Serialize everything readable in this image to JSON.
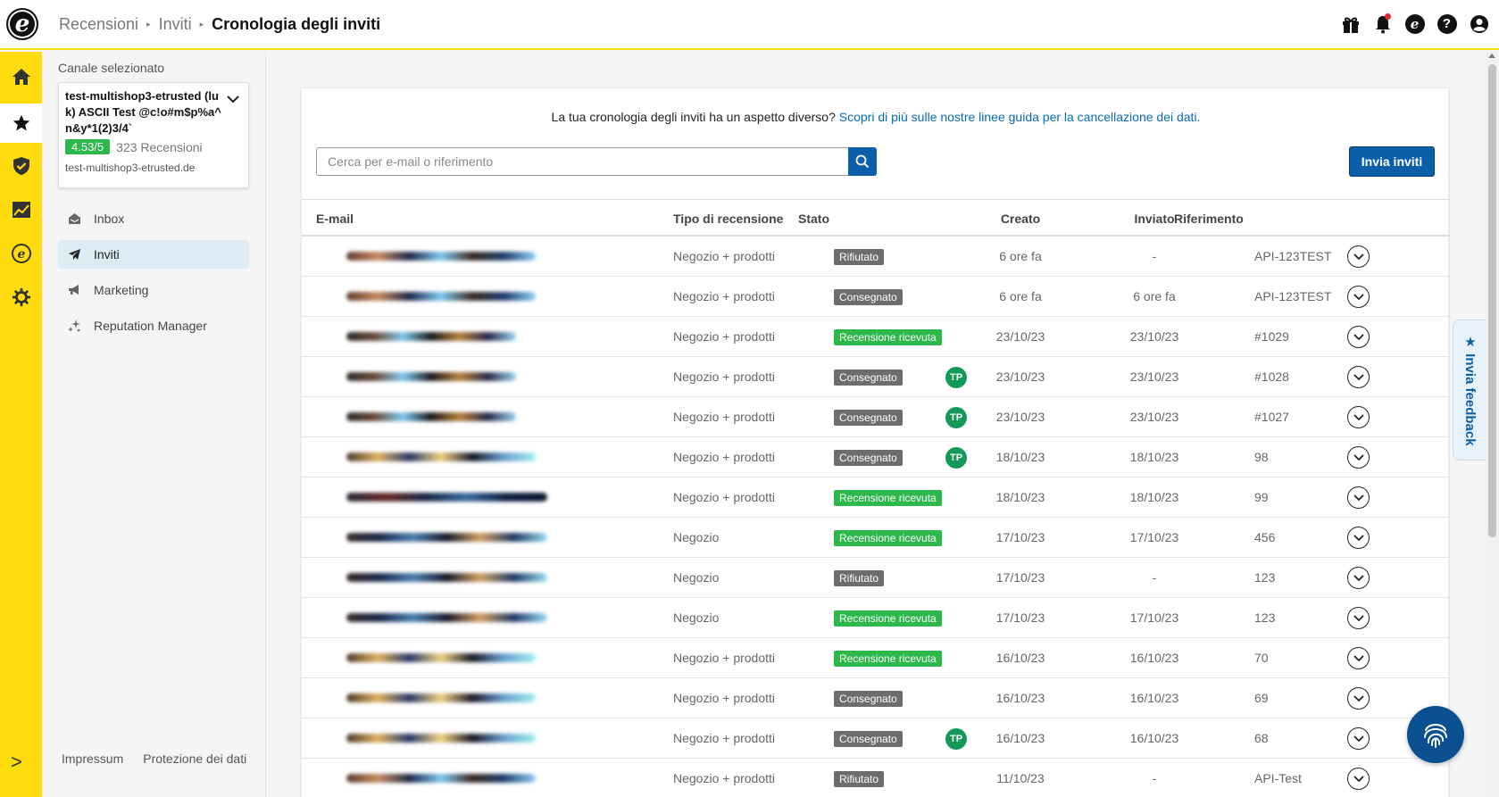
{
  "header": {
    "logo": "e",
    "breadcrumbs": [
      "Recensioni",
      "Inviti"
    ],
    "current": "Cronologia degli inviti",
    "icons": [
      "gift-icon",
      "bell-icon",
      "etrusted-icon",
      "help-icon",
      "account-icon"
    ],
    "etrusted_glyph": "e",
    "help_glyph": "?"
  },
  "rail": {
    "items": [
      "home-icon",
      "star-icon",
      "shield-icon",
      "chart-icon",
      "etrusted-icon",
      "gear-icon"
    ],
    "active_index": 1,
    "expand_glyph": ">"
  },
  "sidepanel": {
    "channel_label": "Canale selezionato",
    "channel_name": "test-multishop3-etrusted (luk) ASCII Test @c!o#m$p%a^n&y*1(2)3/4`",
    "rating": "4.53/5",
    "review_count": "323 Recensioni",
    "channel_url": "test-multishop3-etrusted.de",
    "nav": [
      {
        "label": "Inbox",
        "icon": "inbox-icon"
      },
      {
        "label": "Inviti",
        "icon": "paper-plane-icon"
      },
      {
        "label": "Marketing",
        "icon": "megaphone-icon"
      },
      {
        "label": "Reputation Manager",
        "icon": "sparkle-icon"
      }
    ],
    "footer": [
      "Impressum",
      "Protezione dei dati"
    ]
  },
  "main": {
    "notice_text": "La tua cronologia degli inviti ha un aspetto diverso? ",
    "notice_link": "Scopri di più sulle nostre linee guida per la cancellazione dei dati.",
    "search_placeholder": "Cerca per e-mail o riferimento",
    "send_button": "Invia inviti",
    "columns": [
      "E-mail",
      "Tipo di recensione",
      "Stato",
      "Creato",
      "Inviato",
      "Riferimento"
    ],
    "rows": [
      {
        "type": "Negozio + prodotti",
        "status": "Rifiutato",
        "status_color": "grey",
        "tp": "",
        "created": "6 ore fa",
        "sent": "-",
        "ref": "API-123TEST"
      },
      {
        "type": "Negozio + prodotti",
        "status": "Consegnato",
        "status_color": "grey",
        "tp": "",
        "created": "6 ore fa",
        "sent": "6 ore fa",
        "ref": "API-123TEST"
      },
      {
        "type": "Negozio + prodotti",
        "status": "Recensione ricevuta",
        "status_color": "green",
        "tp": "",
        "created": "23/10/23",
        "sent": "23/10/23",
        "ref": "#1029"
      },
      {
        "type": "Negozio + prodotti",
        "status": "Consegnato",
        "status_color": "grey",
        "tp": "TP",
        "created": "23/10/23",
        "sent": "23/10/23",
        "ref": "#1028"
      },
      {
        "type": "Negozio + prodotti",
        "status": "Consegnato",
        "status_color": "grey",
        "tp": "TP",
        "created": "23/10/23",
        "sent": "23/10/23",
        "ref": "#1027"
      },
      {
        "type": "Negozio + prodotti",
        "status": "Consegnato",
        "status_color": "grey",
        "tp": "TP",
        "created": "18/10/23",
        "sent": "18/10/23",
        "ref": "98"
      },
      {
        "type": "Negozio + prodotti",
        "status": "Recensione ricevuta",
        "status_color": "green",
        "tp": "",
        "created": "18/10/23",
        "sent": "18/10/23",
        "ref": "99"
      },
      {
        "type": "Negozio",
        "status": "Recensione ricevuta",
        "status_color": "green",
        "tp": "",
        "created": "17/10/23",
        "sent": "17/10/23",
        "ref": "456"
      },
      {
        "type": "Negozio",
        "status": "Rifiutato",
        "status_color": "grey",
        "tp": "",
        "created": "17/10/23",
        "sent": "-",
        "ref": "123"
      },
      {
        "type": "Negozio",
        "status": "Recensione ricevuta",
        "status_color": "green",
        "tp": "",
        "created": "17/10/23",
        "sent": "17/10/23",
        "ref": "123"
      },
      {
        "type": "Negozio + prodotti",
        "status": "Recensione ricevuta",
        "status_color": "green",
        "tp": "",
        "created": "16/10/23",
        "sent": "16/10/23",
        "ref": "70"
      },
      {
        "type": "Negozio + prodotti",
        "status": "Consegnato",
        "status_color": "grey",
        "tp": "",
        "created": "16/10/23",
        "sent": "16/10/23",
        "ref": "69"
      },
      {
        "type": "Negozio + prodotti",
        "status": "Consegnato",
        "status_color": "grey",
        "tp": "TP",
        "created": "16/10/23",
        "sent": "16/10/23",
        "ref": "68"
      },
      {
        "type": "Negozio + prodotti",
        "status": "Rifiutato",
        "status_color": "grey",
        "tp": "",
        "created": "11/10/23",
        "sent": "-",
        "ref": "API-Test"
      }
    ]
  },
  "feedback_tab": "★ Invia feedback",
  "fab_icon": "fingerprint-icon",
  "colors": {
    "brand_yellow": "#ffdc0f",
    "primary_blue": "#0a5fa8",
    "success_green": "#2db84b",
    "status_grey": "#6d6d6d",
    "tp_green": "#149a56"
  }
}
